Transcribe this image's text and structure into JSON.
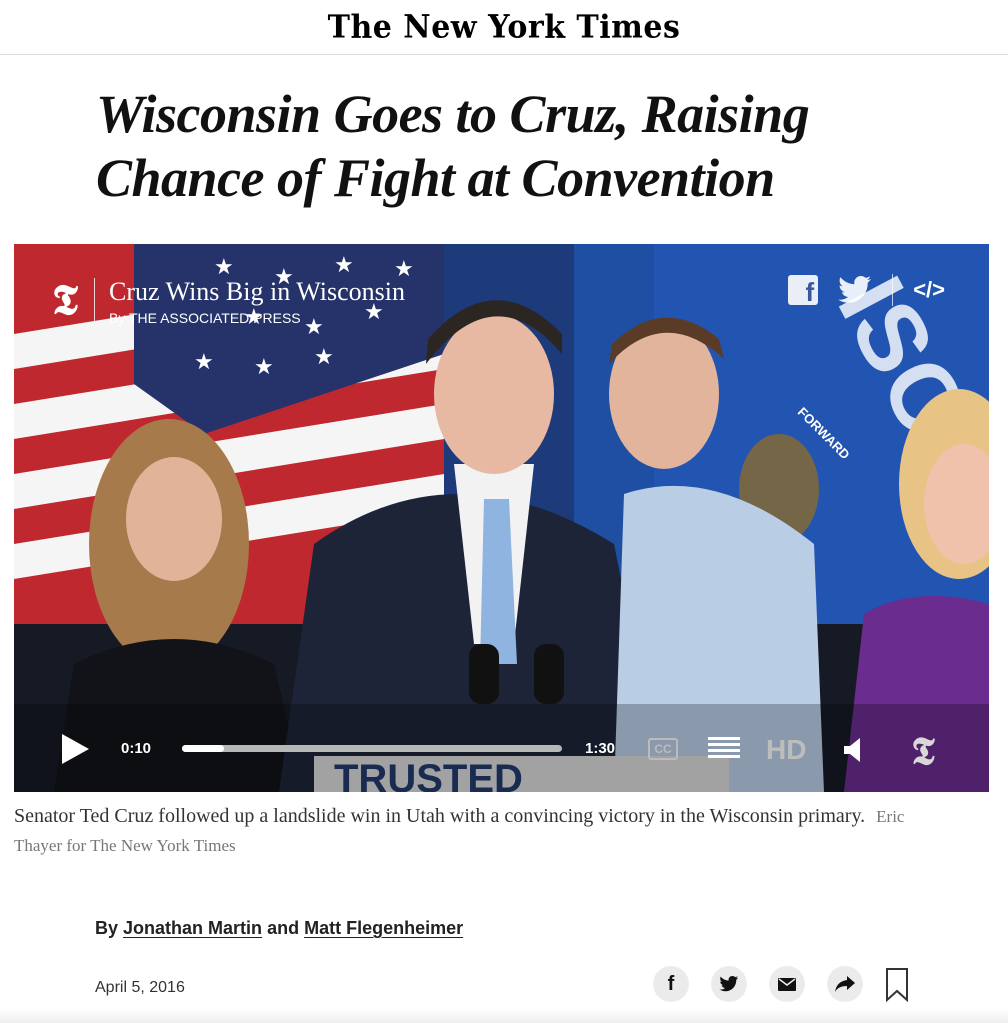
{
  "masthead": {
    "logo_text": "The New York Times"
  },
  "article": {
    "headline": "Wisconsin Goes to Cruz, Raising Chance of Fight at Convention",
    "byline_prefix": "By",
    "author_1": "Jonathan Martin",
    "byline_and": "and",
    "author_2": "Matt Flegenheimer",
    "date": "April 5, 2016"
  },
  "video": {
    "title": "Cruz Wins Big in Wisconsin",
    "credit": "By THE ASSOCIATED PRESS",
    "current_time": "0:10",
    "total_time": "1:30",
    "progress": 0.111,
    "cc_label": "CC",
    "hd_label": "HD",
    "embed_label": "</>",
    "podium_text": "TRUSTED",
    "flag_text": "ISCO",
    "flag_motto": "FORWARD",
    "icons": [
      "nyt-t-icon",
      "facebook-icon",
      "twitter-icon",
      "embed-icon",
      "play-icon",
      "cc-icon",
      "transcript-icon",
      "hd-icon",
      "volume-icon",
      "fullscreen-icon"
    ]
  },
  "caption": {
    "text": "Senator Ted Cruz followed up a landslide win in Utah with a convincing victory in the Wisconsin primary.",
    "credit": "Eric Thayer for The New York Times"
  },
  "share": {
    "icons": [
      "facebook-icon",
      "twitter-icon",
      "email-icon",
      "share-arrow-icon",
      "bookmark-icon"
    ],
    "fb_glyph": "f",
    "tw_glyph": "🐦",
    "mail_glyph": "✉",
    "arrow_glyph": "➦"
  },
  "colors": {
    "flag_blue": "#1f4fa3",
    "flag_red": "#c0282f",
    "navy_suit": "#1e2438",
    "tie_blue": "#8fb4e0"
  }
}
